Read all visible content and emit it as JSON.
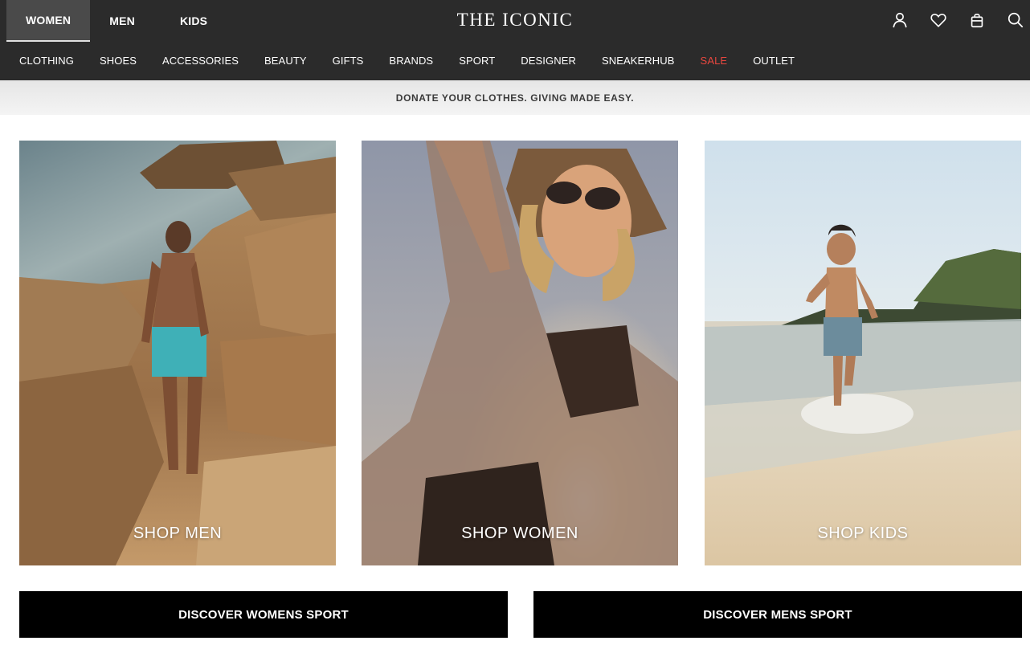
{
  "header": {
    "logo": "THE ICONIC",
    "gender_tabs": [
      {
        "label": "WOMEN",
        "active": true
      },
      {
        "label": "MEN",
        "active": false
      },
      {
        "label": "KIDS",
        "active": false
      }
    ],
    "icons": [
      "account-icon",
      "wishlist-heart-icon",
      "shopping-bag-icon",
      "search-icon"
    ],
    "categories": [
      {
        "label": "CLOTHING"
      },
      {
        "label": "SHOES"
      },
      {
        "label": "ACCESSORIES"
      },
      {
        "label": "BEAUTY"
      },
      {
        "label": "GIFTS"
      },
      {
        "label": "BRANDS"
      },
      {
        "label": "SPORT"
      },
      {
        "label": "DESIGNER"
      },
      {
        "label": "SNEAKERHUB"
      },
      {
        "label": "SALE"
      },
      {
        "label": "OUTLET"
      }
    ]
  },
  "promo": {
    "text": "DONATE YOUR CLOTHES. GIVING MADE EASY."
  },
  "tiles": [
    {
      "label": "SHOP MEN"
    },
    {
      "label": "SHOP WOMEN"
    },
    {
      "label": "SHOP KIDS"
    }
  ],
  "sport_buttons": [
    {
      "label": "DISCOVER WOMENS SPORT"
    },
    {
      "label": "DISCOVER MENS SPORT"
    }
  ],
  "colors": {
    "header_bg": "#2b2b2b",
    "active_tab_bg": "#4a4a4a",
    "sale": "#e8473f",
    "button_bg": "#000000"
  }
}
